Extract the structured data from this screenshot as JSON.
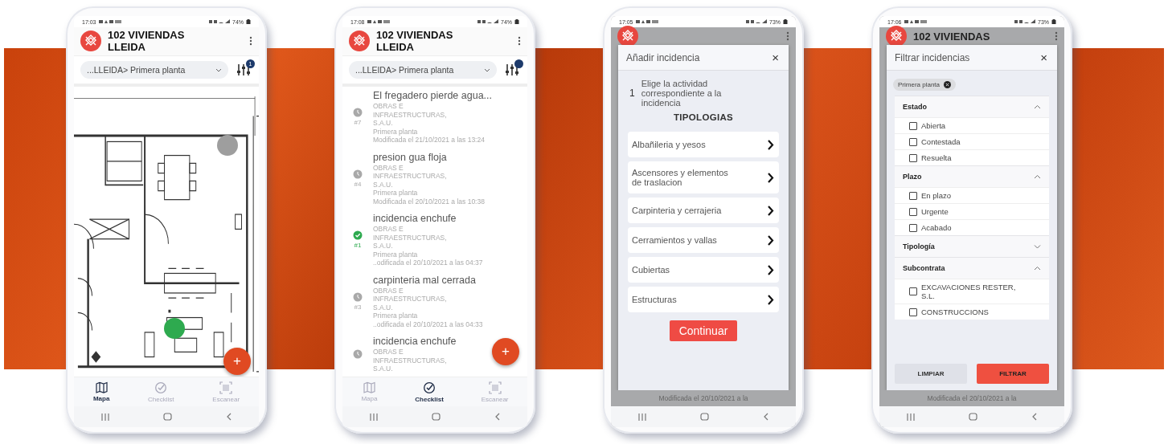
{
  "screens": [
    {
      "kind": "map",
      "status_bar": {
        "time": "17:03",
        "battery": "74%"
      },
      "app_title": "102 VIVIENDAS LLEIDA",
      "location_select": "...LLEIDA> Primera planta",
      "filter_badge": "1",
      "markers": [
        {
          "color": "#9e9e9e"
        },
        {
          "color": "#2eaa4f"
        }
      ],
      "fab": "+",
      "nav": [
        {
          "label": "Mapa",
          "selected": true
        },
        {
          "label": "Checklist",
          "selected": false
        },
        {
          "label": "Escanear",
          "selected": false
        }
      ]
    },
    {
      "kind": "list",
      "status_bar": {
        "time": "17:08",
        "battery": "74%"
      },
      "app_title": "102 VIVIENDAS LLEIDA",
      "location_select": "...LLEIDA> Primera planta",
      "items": [
        {
          "kind": "pending",
          "number": "#7",
          "title": "El fregadero pierde agua...",
          "lines": [
            "OBRAS E INFRAESTRUCTURAS, S.A.U.",
            "Primera planta",
            "Modificada el 21/10/2021 a las 13:24"
          ]
        },
        {
          "kind": "pending",
          "number": "#4",
          "title": "presion gua floja",
          "lines": [
            "OBRAS E INFRAESTRUCTURAS, S.A.U.",
            "Primera planta",
            "Modificada el 20/10/2021 a las 10:38"
          ]
        },
        {
          "kind": "resolved",
          "number": "#1",
          "title": "incidencia enchufe",
          "lines": [
            "OBRAS E INFRAESTRUCTURAS, S.A.U.",
            "Primera planta",
            "..odificada el 20/10/2021 a las 04:37"
          ]
        },
        {
          "kind": "pending",
          "number": "#3",
          "title": "carpinteria mal cerrada",
          "lines": [
            "OBRAS E INFRAESTRUCTURAS, S.A.U.",
            "Primera planta",
            "..odificada el 20/10/2021 a las 04:33"
          ]
        },
        {
          "kind": "pending",
          "title": "incidencia enchufe",
          "lines": [
            "OBRAS E INFRAESTRUCTURAS, S.A.U."
          ]
        }
      ],
      "fab": "+",
      "nav": [
        {
          "label": "Mapa",
          "selected": false
        },
        {
          "label": "Checklist",
          "selected": true
        },
        {
          "label": "Escanear",
          "selected": false
        }
      ]
    },
    {
      "kind": "add_modal",
      "status_bar": {
        "time": "17:05",
        "battery": "73%"
      },
      "modal_title": "Añadir incidencia",
      "close": "×",
      "step_number": "1",
      "step_text": "Elige la actividad correspondiente a la incidencia",
      "section_title": "TIPOLOGIAS",
      "options": [
        "Albañileria y yesos",
        "Ascensores y elementos de traslacion",
        "Carpinteria y cerrajeria",
        "Cerramientos y vallas",
        "Cubiertas",
        "Estructuras"
      ],
      "continue_button": "Continuar",
      "behind_text": "Modificada el 20/10/2021 a la"
    },
    {
      "kind": "filter_modal",
      "status_bar": {
        "time": "17:06",
        "battery": "73%"
      },
      "app_title": "102 VIVIENDAS",
      "modal_title": "Filtrar incidencias",
      "close": "×",
      "chip": "Primera planta",
      "sections": [
        {
          "title": "Estado",
          "expanded": true,
          "options": [
            {
              "label": "Abierta",
              "checked": false
            },
            {
              "label": "Contestada",
              "checked": false
            },
            {
              "label": "Resuelta",
              "checked": false
            }
          ]
        },
        {
          "title": "Plazo",
          "expanded": true,
          "options": [
            {
              "label": "En plazo",
              "checked": false
            },
            {
              "label": "Urgente",
              "checked": false
            },
            {
              "label": "Acabado",
              "checked": false
            }
          ]
        },
        {
          "title": "Tipología",
          "expanded": false
        },
        {
          "title": "Subcontrata",
          "expanded": true,
          "options": [
            {
              "label": "EXCAVACIONES RESTER, S.L.",
              "checked": false
            },
            {
              "label": "CONSTRUCCIONS",
              "checked": false
            }
          ]
        }
      ],
      "clear_button": "LIMPIAR",
      "apply_button": "FILTRAR",
      "behind_text": "Modificada el 20/10/2021 a la"
    }
  ]
}
